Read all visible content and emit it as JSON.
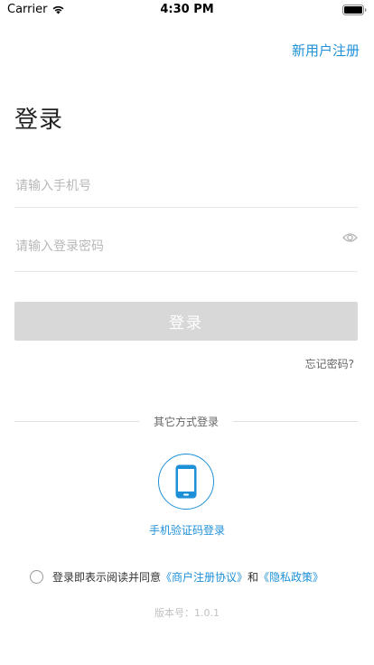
{
  "status_bar": {
    "carrier": "Carrier",
    "time": "4:30 PM",
    "wifi_icon": "wifi-icon",
    "battery_icon": "battery-full-icon"
  },
  "header": {
    "register_label": "新用户注册"
  },
  "title": "登录",
  "form": {
    "phone_placeholder": "请输入手机号",
    "password_placeholder": "请输入登录密码",
    "password_toggle_icon": "eye-icon",
    "login_label": "登录",
    "forgot_label": "忘记密码?"
  },
  "other_methods": {
    "divider_label": "其它方式登录",
    "phone_icon": "mobile-phone-icon",
    "phone_code_label": "手机验证码登录"
  },
  "agreement": {
    "checked": false,
    "prefix": "登录即表示阅读并同意",
    "terms_link": "《商户注册协议》",
    "connector": "和",
    "privacy_link": "《隐私政策》"
  },
  "version": "版本号：1.0.1",
  "colors": {
    "accent": "#1e90d8",
    "button_disabled": "#d8d8d8",
    "placeholder": "#b8b8b8",
    "divider": "#e0e0e0"
  }
}
